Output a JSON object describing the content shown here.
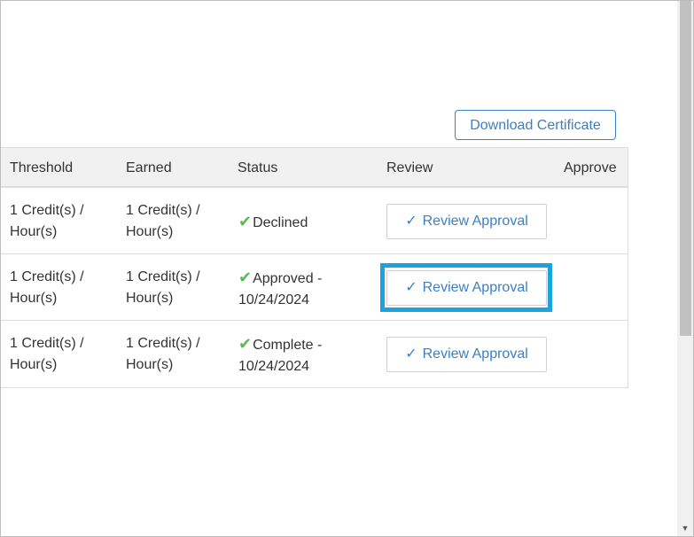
{
  "actions": {
    "download_certificate_label": "Download Certificate"
  },
  "table": {
    "headers": {
      "threshold": "Threshold",
      "earned": "Earned",
      "status": "Status",
      "review": "Review",
      "approve": "Approve"
    },
    "rows": [
      {
        "threshold_line1": "1 Credit(s) /",
        "threshold_line2": "Hour(s)",
        "earned_line1": "1 Credit(s) /",
        "earned_line2": "Hour(s)",
        "status_line1": "Declined",
        "status_line2": "",
        "review_label": "Review Approval"
      },
      {
        "threshold_line1": "1 Credit(s) /",
        "threshold_line2": "Hour(s)",
        "earned_line1": "1 Credit(s) /",
        "earned_line2": "Hour(s)",
        "status_line1": "Approved -",
        "status_line2": "10/24/2024",
        "review_label": "Review Approval"
      },
      {
        "threshold_line1": "1 Credit(s) /",
        "threshold_line2": "Hour(s)",
        "earned_line1": "1 Credit(s) /",
        "earned_line2": "Hour(s)",
        "status_line1": "Complete -",
        "status_line2": "10/24/2024",
        "review_label": "Review Approval"
      }
    ]
  },
  "icons": {
    "status_check": "check-icon",
    "review_check": "check-icon",
    "scroll_down": "chevron-down-icon"
  },
  "colors": {
    "accent": "#3b7fc4",
    "success": "#5cb85c",
    "highlight": "#1ba3e0",
    "header_bg": "#f1f1f1"
  }
}
